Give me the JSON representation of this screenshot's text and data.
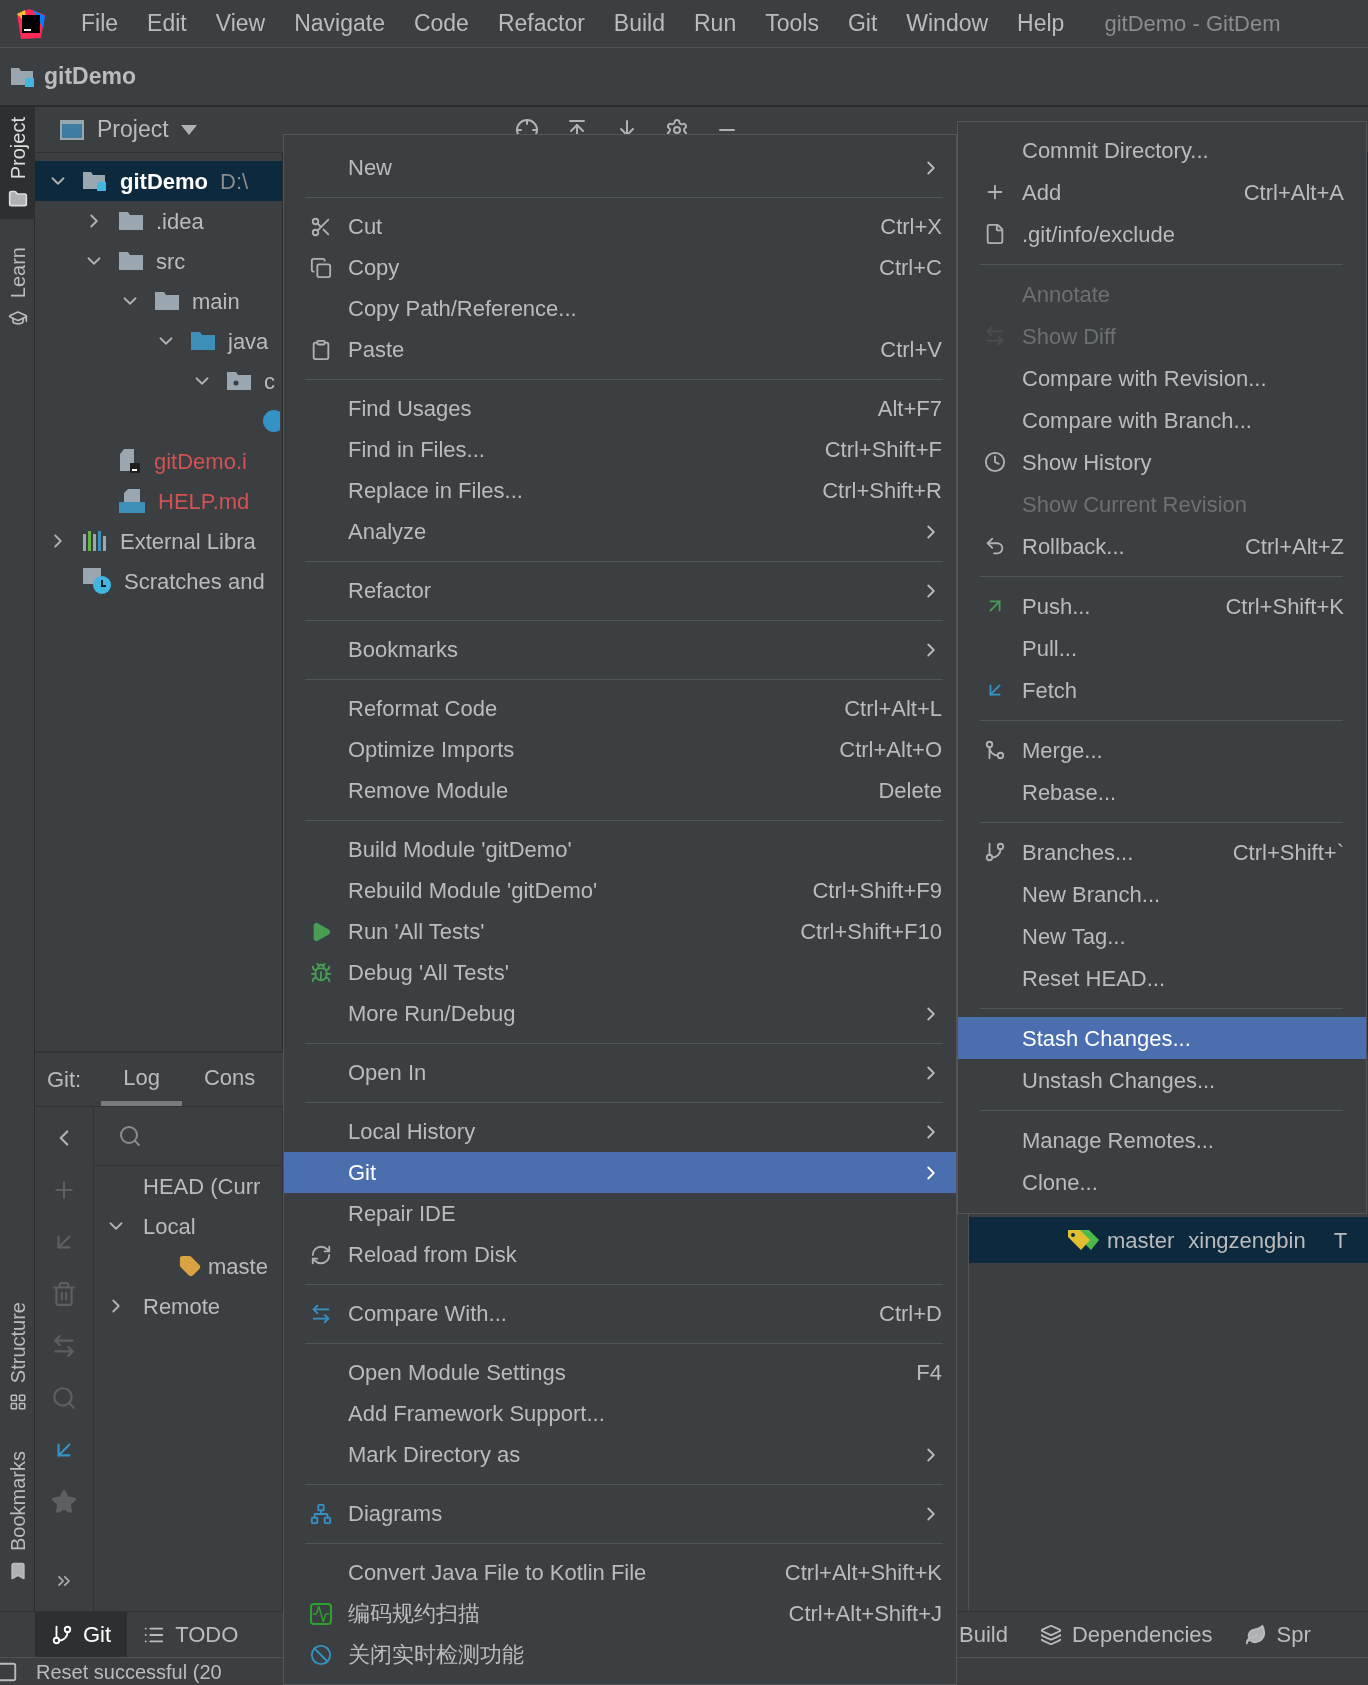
{
  "menubar": {
    "items": [
      "File",
      "Edit",
      "View",
      "Navigate",
      "Code",
      "Refactor",
      "Build",
      "Run",
      "Tools",
      "Git",
      "Window",
      "Help"
    ],
    "title": "gitDemo - GitDem"
  },
  "breadcrumb": "gitDemo",
  "side_tabs": [
    {
      "label": "Project",
      "selected": true
    },
    {
      "label": "Learn",
      "selected": false
    },
    {
      "label": "Structure",
      "selected": false
    },
    {
      "label": "Bookmarks",
      "selected": false
    }
  ],
  "project_panel": {
    "title": "Project",
    "tree": [
      {
        "label": "gitDemo",
        "path": "D:\\",
        "kind": "module",
        "expanded": true,
        "selected": true,
        "children": [
          {
            "label": ".idea",
            "kind": "folder",
            "expanded": false,
            "selected": false,
            "color": "#bbbbbb"
          },
          {
            "label": "src",
            "kind": "folder",
            "expanded": true,
            "selected": false,
            "color": "#bbbbbb",
            "children": [
              {
                "label": "main",
                "kind": "folder",
                "expanded": true,
                "selected": false,
                "color": "#bbbbbb",
                "children": [
                  {
                    "label": "java",
                    "kind": "source",
                    "expanded": true,
                    "selected": false,
                    "color": "#bbbbbb",
                    "children": [
                      {
                        "label": "c",
                        "kind": "package",
                        "expanded": true,
                        "selected": false,
                        "color": "#bbbbbb",
                        "children": [
                          {
                            "kind": "class"
                          }
                        ]
                      }
                    ]
                  }
                ]
              }
            ]
          },
          {
            "label": "gitDemo.i",
            "kind": "iml",
            "selected": false,
            "color": "#d25252"
          },
          {
            "label": "HELP.md",
            "kind": "md",
            "selected": false,
            "color": "#d25252"
          }
        ]
      },
      {
        "label": "External Libra",
        "kind": "libraries",
        "expanded": false,
        "selected": false,
        "color": "#bbbbbb"
      },
      {
        "label": "Scratches and",
        "kind": "scratches",
        "selected": false,
        "color": "#bbbbbb"
      }
    ]
  },
  "git_window": {
    "label": "Git:",
    "tabs": [
      {
        "label": "Log",
        "selected": true
      },
      {
        "label": "Cons",
        "selected": false
      }
    ],
    "branches": [
      {
        "label": "HEAD (Curr"
      },
      {
        "label": "Local",
        "expanded": true,
        "children": [
          {
            "label": "maste",
            "kind": "branch"
          }
        ]
      },
      {
        "label": "Remote",
        "expanded": false
      }
    ],
    "log_row": {
      "branch": "master",
      "author": "xingzengbin",
      "column_3": "T",
      "selected": true
    }
  },
  "context_menu": {
    "sections": [
      [
        {
          "label": "New",
          "submenu": true,
          "selected": false
        }
      ],
      [
        {
          "label": "Cut",
          "shortcut": "Ctrl+X",
          "submenu": false,
          "selected": false
        },
        {
          "label": "Copy",
          "shortcut": "Ctrl+C",
          "submenu": false,
          "selected": false
        },
        {
          "label": "Copy Path/Reference...",
          "submenu": false,
          "selected": false
        },
        {
          "label": "Paste",
          "shortcut": "Ctrl+V",
          "submenu": false,
          "selected": false
        }
      ],
      [
        {
          "label": "Find Usages",
          "shortcut": "Alt+F7",
          "submenu": false,
          "selected": false
        },
        {
          "label": "Find in Files...",
          "shortcut": "Ctrl+Shift+F",
          "submenu": false,
          "selected": false
        },
        {
          "label": "Replace in Files...",
          "shortcut": "Ctrl+Shift+R",
          "submenu": false,
          "selected": false
        },
        {
          "label": "Analyze",
          "submenu": true,
          "selected": false
        }
      ],
      [
        {
          "label": "Refactor",
          "submenu": true,
          "selected": false
        }
      ],
      [
        {
          "label": "Bookmarks",
          "submenu": true,
          "selected": false
        }
      ],
      [
        {
          "label": "Reformat Code",
          "shortcut": "Ctrl+Alt+L",
          "submenu": false,
          "selected": false
        },
        {
          "label": "Optimize Imports",
          "shortcut": "Ctrl+Alt+O",
          "submenu": false,
          "selected": false
        },
        {
          "label": "Remove Module",
          "shortcut": "Delete",
          "submenu": false,
          "selected": false
        }
      ],
      [
        {
          "label": "Build Module 'gitDemo'",
          "submenu": false,
          "selected": false
        },
        {
          "label": "Rebuild Module 'gitDemo'",
          "shortcut": "Ctrl+Shift+F9",
          "submenu": false,
          "selected": false
        },
        {
          "label": "Run 'All Tests'",
          "shortcut": "Ctrl+Shift+F10",
          "submenu": false,
          "selected": false
        },
        {
          "label": "Debug 'All Tests'",
          "submenu": false,
          "selected": false
        },
        {
          "label": "More Run/Debug",
          "submenu": true,
          "selected": false
        }
      ],
      [
        {
          "label": "Open In",
          "submenu": true,
          "selected": false
        }
      ],
      [
        {
          "label": "Local History",
          "submenu": true,
          "selected": false
        },
        {
          "label": "Git",
          "submenu": true,
          "selected": true
        },
        {
          "label": "Repair IDE",
          "submenu": false,
          "selected": false
        },
        {
          "label": "Reload from Disk",
          "submenu": false,
          "selected": false
        }
      ],
      [
        {
          "label": "Compare With...",
          "shortcut": "Ctrl+D",
          "submenu": false,
          "selected": false
        }
      ],
      [
        {
          "label": "Open Module Settings",
          "shortcut": "F4",
          "submenu": false,
          "selected": false
        },
        {
          "label": "Add Framework Support...",
          "submenu": false,
          "selected": false
        },
        {
          "label": "Mark Directory as",
          "submenu": true,
          "selected": false
        }
      ],
      [
        {
          "label": "Diagrams",
          "submenu": true,
          "selected": false
        }
      ],
      [
        {
          "label": "Convert Java File to Kotlin File",
          "shortcut": "Ctrl+Alt+Shift+K",
          "submenu": false,
          "selected": false
        },
        {
          "label": "编码规约扫描",
          "shortcut": "Ctrl+Alt+Shift+J",
          "submenu": false,
          "selected": false
        },
        {
          "label": "关闭实时检测功能",
          "submenu": false,
          "selected": false
        }
      ]
    ]
  },
  "git_submenu": {
    "sections": [
      [
        {
          "label": "Commit Directory...",
          "disabled": false,
          "selected": false
        },
        {
          "label": "Add",
          "shortcut": "Ctrl+Alt+A",
          "disabled": false,
          "selected": false
        },
        {
          "label": ".git/info/exclude",
          "disabled": false,
          "selected": false
        }
      ],
      [
        {
          "label": "Annotate",
          "disabled": true,
          "selected": false
        },
        {
          "label": "Show Diff",
          "disabled": true,
          "selected": false
        },
        {
          "label": "Compare with Revision...",
          "disabled": false,
          "selected": false
        },
        {
          "label": "Compare with Branch...",
          "disabled": false,
          "selected": false
        },
        {
          "label": "Show History",
          "disabled": false,
          "selected": false
        },
        {
          "label": "Show Current Revision",
          "disabled": true,
          "selected": false
        },
        {
          "label": "Rollback...",
          "shortcut": "Ctrl+Alt+Z",
          "disabled": false,
          "selected": false
        }
      ],
      [
        {
          "label": "Push...",
          "shortcut": "Ctrl+Shift+K",
          "disabled": false,
          "selected": false
        },
        {
          "label": "Pull...",
          "disabled": false,
          "selected": false
        },
        {
          "label": "Fetch",
          "disabled": false,
          "selected": false
        }
      ],
      [
        {
          "label": "Merge...",
          "disabled": false,
          "selected": false
        },
        {
          "label": "Rebase...",
          "disabled": false,
          "selected": false
        }
      ],
      [
        {
          "label": "Branches...",
          "shortcut": "Ctrl+Shift+`",
          "disabled": false,
          "selected": false
        },
        {
          "label": "New Branch...",
          "disabled": false,
          "selected": false
        },
        {
          "label": "New Tag...",
          "disabled": false,
          "selected": false
        },
        {
          "label": "Reset HEAD...",
          "disabled": false,
          "selected": false
        }
      ],
      [
        {
          "label": "Stash Changes...",
          "disabled": false,
          "selected": true
        },
        {
          "label": "Unstash Changes...",
          "disabled": false,
          "selected": false
        }
      ],
      [
        {
          "label": "Manage Remotes...",
          "disabled": false,
          "selected": false
        },
        {
          "label": "Clone...",
          "disabled": false,
          "selected": false
        }
      ]
    ]
  },
  "bottom_bar": {
    "tools": [
      {
        "label": "Git",
        "selected": true
      },
      {
        "label": "TODO",
        "selected": false
      },
      {
        "label": "Build",
        "selected": false
      },
      {
        "label": "Dependencies",
        "selected": false
      },
      {
        "label": "Spr",
        "selected": false
      }
    ]
  },
  "status_bar": {
    "message": "Reset successful (20"
  }
}
